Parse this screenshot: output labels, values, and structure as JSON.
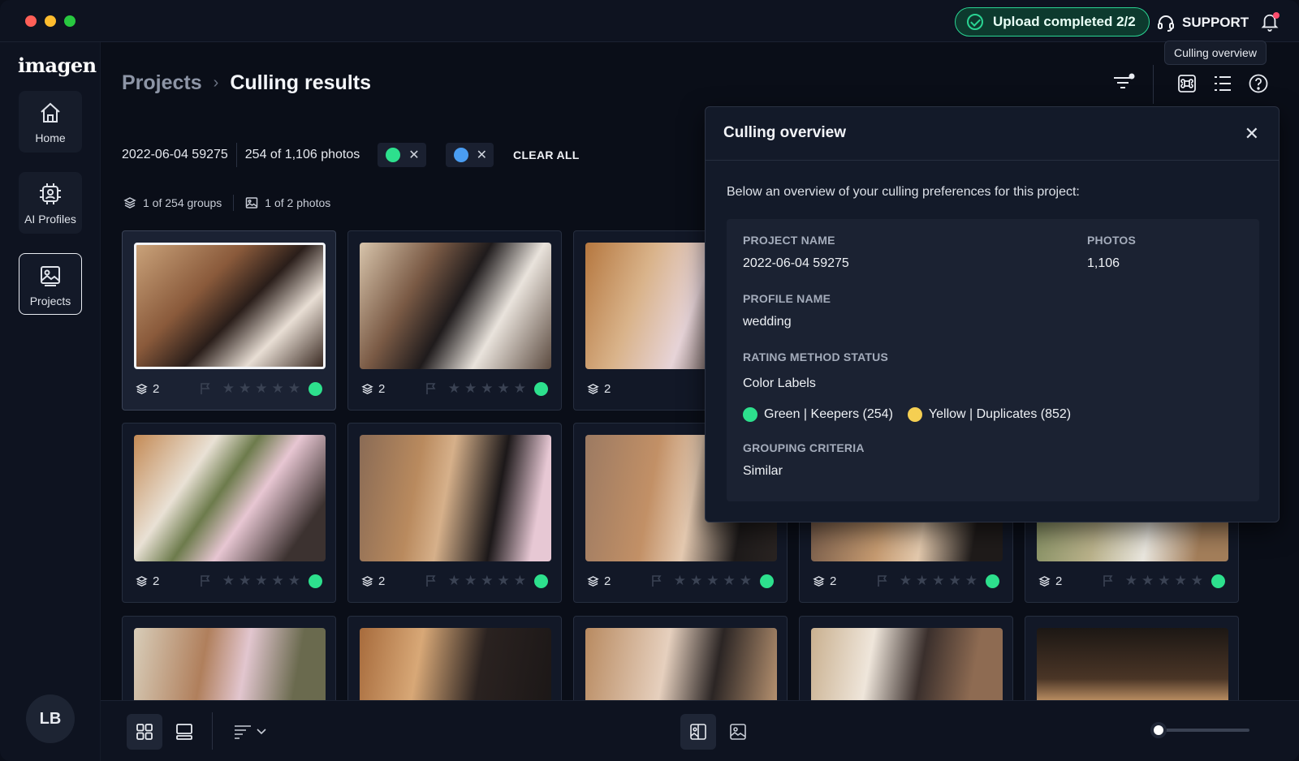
{
  "topbar": {
    "upload_status": "Upload completed 2/2",
    "support_label": "SUPPORT",
    "tooltip": "Culling overview"
  },
  "sidebar": {
    "logo": "imagen",
    "items": [
      {
        "label": "Home",
        "icon": "home-icon"
      },
      {
        "label": "AI Profiles",
        "icon": "ai-chip-icon"
      },
      {
        "label": "Projects",
        "icon": "image-gallery-icon"
      }
    ],
    "avatar_initials": "LB"
  },
  "header": {
    "breadcrumb_root": "Projects",
    "breadcrumb_sep": "›",
    "title": "Culling results"
  },
  "filters": {
    "project": "2022-06-04 59275",
    "photo_count": "254 of 1,106 photos",
    "chips": [
      {
        "color": "#2de08d",
        "remove": "✕"
      },
      {
        "color": "#4a9df2",
        "remove": "✕"
      }
    ],
    "clear_all": "CLEAR ALL"
  },
  "group_info": {
    "groups": "1 of 254 groups",
    "photos": "1 of 2 photos"
  },
  "cards": [
    {
      "count": "2",
      "rating": 0,
      "label_color": "green",
      "selected": true
    },
    {
      "count": "2",
      "rating": 0,
      "label_color": "green"
    },
    {
      "count": "2",
      "rating": 0,
      "label_color": "green"
    },
    {
      "count": "2",
      "rating": 0,
      "label_color": "green"
    },
    {
      "count": "2",
      "rating": 0,
      "label_color": "green"
    },
    {
      "count": "2",
      "rating": 0,
      "label_color": "green"
    },
    {
      "count": "2",
      "rating": 0,
      "label_color": "green"
    },
    {
      "count": "2",
      "rating": 0,
      "label_color": "green"
    }
  ],
  "panel": {
    "title": "Culling overview",
    "close": "✕",
    "intro": "Below an overview of your culling preferences for this project:",
    "project_name_label": "PROJECT NAME",
    "project_name": "2022-06-04 59275",
    "photos_label": "PHOTOS",
    "photos": "1,106",
    "profile_name_label": "PROFILE NAME",
    "profile_name": "wedding",
    "rating_label": "RATING METHOD STATUS",
    "rating_value": "Color Labels",
    "legend": [
      {
        "text": "Green | Keepers (254)",
        "color": "#2de08d"
      },
      {
        "text": "Yellow | Duplicates (852)",
        "color": "#f5cf52"
      }
    ],
    "grouping_label": "GROUPING CRITERIA",
    "grouping_value": "Similar"
  },
  "colors": {
    "accent_green": "#2ad493",
    "label_green": "#2de08d",
    "label_blue": "#4a9df2",
    "label_yellow": "#f5cf52"
  }
}
